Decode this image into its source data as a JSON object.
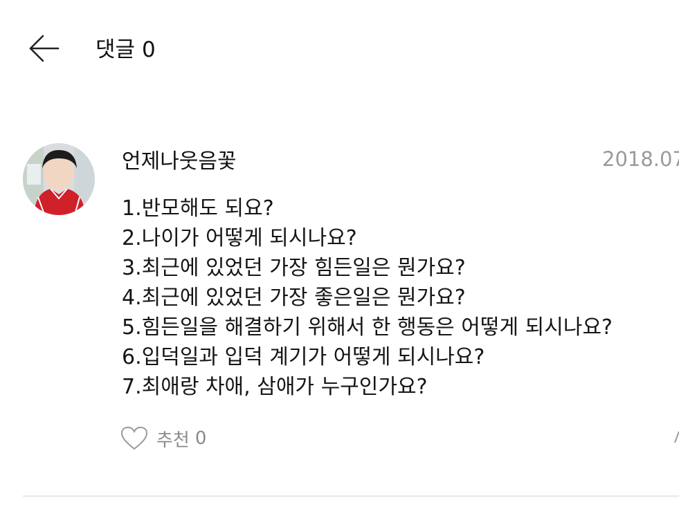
{
  "header": {
    "back_icon": "arrow-left-icon",
    "title": "댓글",
    "comment_count": "0"
  },
  "comment": {
    "avatar": "avatar-photo",
    "author": "언제나웃음꽃",
    "date": "2018.07",
    "lines": [
      "1.반모해도 되요?",
      "2.나이가 어떻게 되시나요?",
      "3.최근에 있었던 가장 힘든일은 뭔가요?",
      "4.최근에 있었던 가장 좋은일은 뭔가요?",
      "5.힘든일을 해결하기 위해서 한 행동은 어떻게 되시나요?",
      "6.입덕일과 입덕 계기가 어떻게 되시나요?",
      "7.최애랑 차애, 삼애가 누구인가요?"
    ],
    "like_icon": "heart-outline-icon",
    "like_label": "추천",
    "like_count": "0",
    "more_icon": "more-icon"
  },
  "colors": {
    "background": "#ffffff",
    "text": "#111111",
    "date": "#9a9a9a",
    "muted": "#8a8a8a",
    "divider": "#ededed"
  }
}
